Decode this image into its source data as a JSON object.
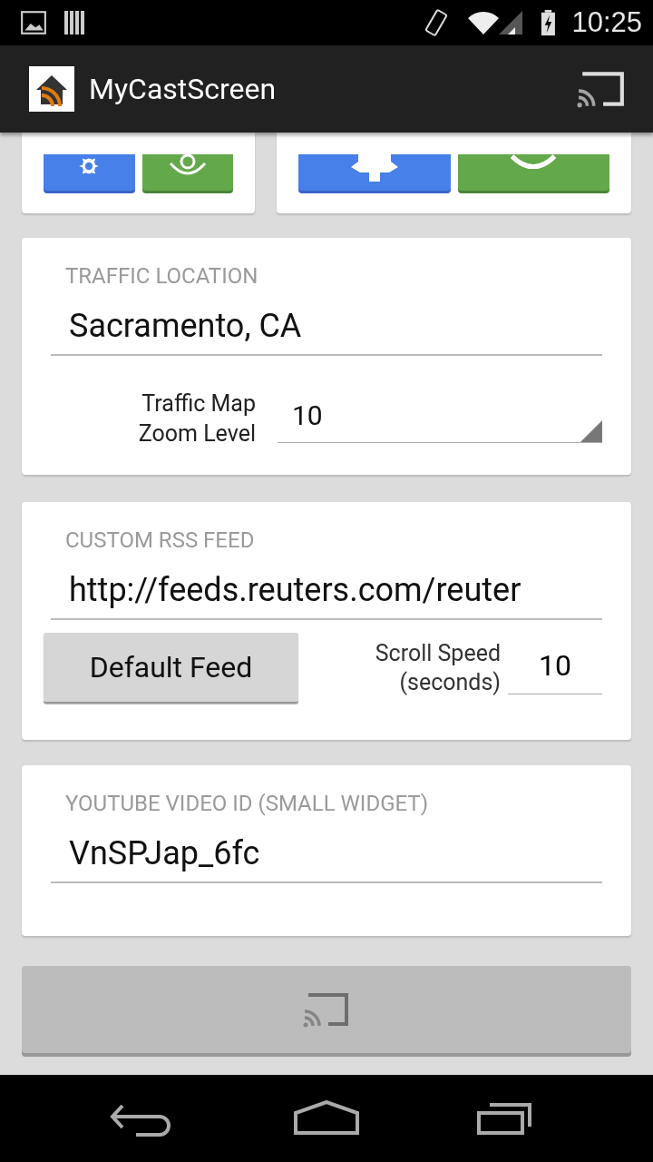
{
  "status_bar": {
    "time": "10:25"
  },
  "app_bar": {
    "title": "MyCastScreen"
  },
  "traffic": {
    "heading": "TRAFFIC LOCATION",
    "location": "Sacramento, CA",
    "zoom_label": "Traffic Map Zoom Level",
    "zoom_value": "10"
  },
  "rss": {
    "heading": "CUSTOM RSS FEED",
    "url": "http://feeds.reuters.com/reuter",
    "default_button": "Default Feed",
    "speed_label": "Scroll Speed (seconds)",
    "speed_value": "10"
  },
  "youtube": {
    "heading": "YOUTUBE VIDEO ID (SMALL WIDGET)",
    "video_id": "VnSPJap_6fc"
  },
  "cast_button": {
    "disabled": true
  }
}
